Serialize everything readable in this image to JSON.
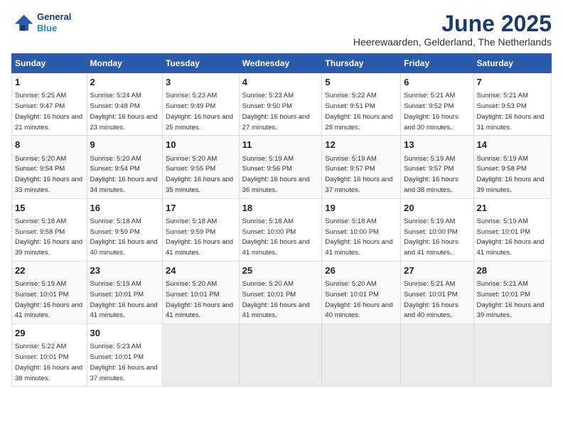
{
  "logo": {
    "line1": "General",
    "line2": "Blue"
  },
  "title": "June 2025",
  "subtitle": "Heerewaarden, Gelderland, The Netherlands",
  "columns": [
    "Sunday",
    "Monday",
    "Tuesday",
    "Wednesday",
    "Thursday",
    "Friday",
    "Saturday"
  ],
  "weeks": [
    [
      {
        "day": "1",
        "sunrise": "Sunrise: 5:25 AM",
        "sunset": "Sunset: 9:47 PM",
        "daylight": "Daylight: 16 hours and 21 minutes."
      },
      {
        "day": "2",
        "sunrise": "Sunrise: 5:24 AM",
        "sunset": "Sunset: 9:48 PM",
        "daylight": "Daylight: 16 hours and 23 minutes."
      },
      {
        "day": "3",
        "sunrise": "Sunrise: 5:23 AM",
        "sunset": "Sunset: 9:49 PM",
        "daylight": "Daylight: 16 hours and 25 minutes."
      },
      {
        "day": "4",
        "sunrise": "Sunrise: 5:23 AM",
        "sunset": "Sunset: 9:50 PM",
        "daylight": "Daylight: 16 hours and 27 minutes."
      },
      {
        "day": "5",
        "sunrise": "Sunrise: 5:22 AM",
        "sunset": "Sunset: 9:51 PM",
        "daylight": "Daylight: 16 hours and 28 minutes."
      },
      {
        "day": "6",
        "sunrise": "Sunrise: 5:21 AM",
        "sunset": "Sunset: 9:52 PM",
        "daylight": "Daylight: 16 hours and 30 minutes."
      },
      {
        "day": "7",
        "sunrise": "Sunrise: 5:21 AM",
        "sunset": "Sunset: 9:53 PM",
        "daylight": "Daylight: 16 hours and 31 minutes."
      }
    ],
    [
      {
        "day": "8",
        "sunrise": "Sunrise: 5:20 AM",
        "sunset": "Sunset: 9:54 PM",
        "daylight": "Daylight: 16 hours and 33 minutes."
      },
      {
        "day": "9",
        "sunrise": "Sunrise: 5:20 AM",
        "sunset": "Sunset: 9:54 PM",
        "daylight": "Daylight: 16 hours and 34 minutes."
      },
      {
        "day": "10",
        "sunrise": "Sunrise: 5:20 AM",
        "sunset": "Sunset: 9:55 PM",
        "daylight": "Daylight: 16 hours and 35 minutes."
      },
      {
        "day": "11",
        "sunrise": "Sunrise: 5:19 AM",
        "sunset": "Sunset: 9:56 PM",
        "daylight": "Daylight: 16 hours and 36 minutes."
      },
      {
        "day": "12",
        "sunrise": "Sunrise: 5:19 AM",
        "sunset": "Sunset: 9:57 PM",
        "daylight": "Daylight: 16 hours and 37 minutes."
      },
      {
        "day": "13",
        "sunrise": "Sunrise: 5:19 AM",
        "sunset": "Sunset: 9:57 PM",
        "daylight": "Daylight: 16 hours and 38 minutes."
      },
      {
        "day": "14",
        "sunrise": "Sunrise: 5:19 AM",
        "sunset": "Sunset: 9:58 PM",
        "daylight": "Daylight: 16 hours and 39 minutes."
      }
    ],
    [
      {
        "day": "15",
        "sunrise": "Sunrise: 5:18 AM",
        "sunset": "Sunset: 9:58 PM",
        "daylight": "Daylight: 16 hours and 39 minutes."
      },
      {
        "day": "16",
        "sunrise": "Sunrise: 5:18 AM",
        "sunset": "Sunset: 9:59 PM",
        "daylight": "Daylight: 16 hours and 40 minutes."
      },
      {
        "day": "17",
        "sunrise": "Sunrise: 5:18 AM",
        "sunset": "Sunset: 9:59 PM",
        "daylight": "Daylight: 16 hours and 41 minutes."
      },
      {
        "day": "18",
        "sunrise": "Sunrise: 5:18 AM",
        "sunset": "Sunset: 10:00 PM",
        "daylight": "Daylight: 16 hours and 41 minutes."
      },
      {
        "day": "19",
        "sunrise": "Sunrise: 5:18 AM",
        "sunset": "Sunset: 10:00 PM",
        "daylight": "Daylight: 16 hours and 41 minutes."
      },
      {
        "day": "20",
        "sunrise": "Sunrise: 5:19 AM",
        "sunset": "Sunset: 10:00 PM",
        "daylight": "Daylight: 16 hours and 41 minutes."
      },
      {
        "day": "21",
        "sunrise": "Sunrise: 5:19 AM",
        "sunset": "Sunset: 10:01 PM",
        "daylight": "Daylight: 16 hours and 41 minutes."
      }
    ],
    [
      {
        "day": "22",
        "sunrise": "Sunrise: 5:19 AM",
        "sunset": "Sunset: 10:01 PM",
        "daylight": "Daylight: 16 hours and 41 minutes."
      },
      {
        "day": "23",
        "sunrise": "Sunrise: 5:19 AM",
        "sunset": "Sunset: 10:01 PM",
        "daylight": "Daylight: 16 hours and 41 minutes."
      },
      {
        "day": "24",
        "sunrise": "Sunrise: 5:20 AM",
        "sunset": "Sunset: 10:01 PM",
        "daylight": "Daylight: 16 hours and 41 minutes."
      },
      {
        "day": "25",
        "sunrise": "Sunrise: 5:20 AM",
        "sunset": "Sunset: 10:01 PM",
        "daylight": "Daylight: 16 hours and 41 minutes."
      },
      {
        "day": "26",
        "sunrise": "Sunrise: 5:20 AM",
        "sunset": "Sunset: 10:01 PM",
        "daylight": "Daylight: 16 hours and 40 minutes."
      },
      {
        "day": "27",
        "sunrise": "Sunrise: 5:21 AM",
        "sunset": "Sunset: 10:01 PM",
        "daylight": "Daylight: 16 hours and 40 minutes."
      },
      {
        "day": "28",
        "sunrise": "Sunrise: 5:21 AM",
        "sunset": "Sunset: 10:01 PM",
        "daylight": "Daylight: 16 hours and 39 minutes."
      }
    ],
    [
      {
        "day": "29",
        "sunrise": "Sunrise: 5:22 AM",
        "sunset": "Sunset: 10:01 PM",
        "daylight": "Daylight: 16 hours and 38 minutes."
      },
      {
        "day": "30",
        "sunrise": "Sunrise: 5:23 AM",
        "sunset": "Sunset: 10:01 PM",
        "daylight": "Daylight: 16 hours and 37 minutes."
      },
      null,
      null,
      null,
      null,
      null
    ]
  ]
}
